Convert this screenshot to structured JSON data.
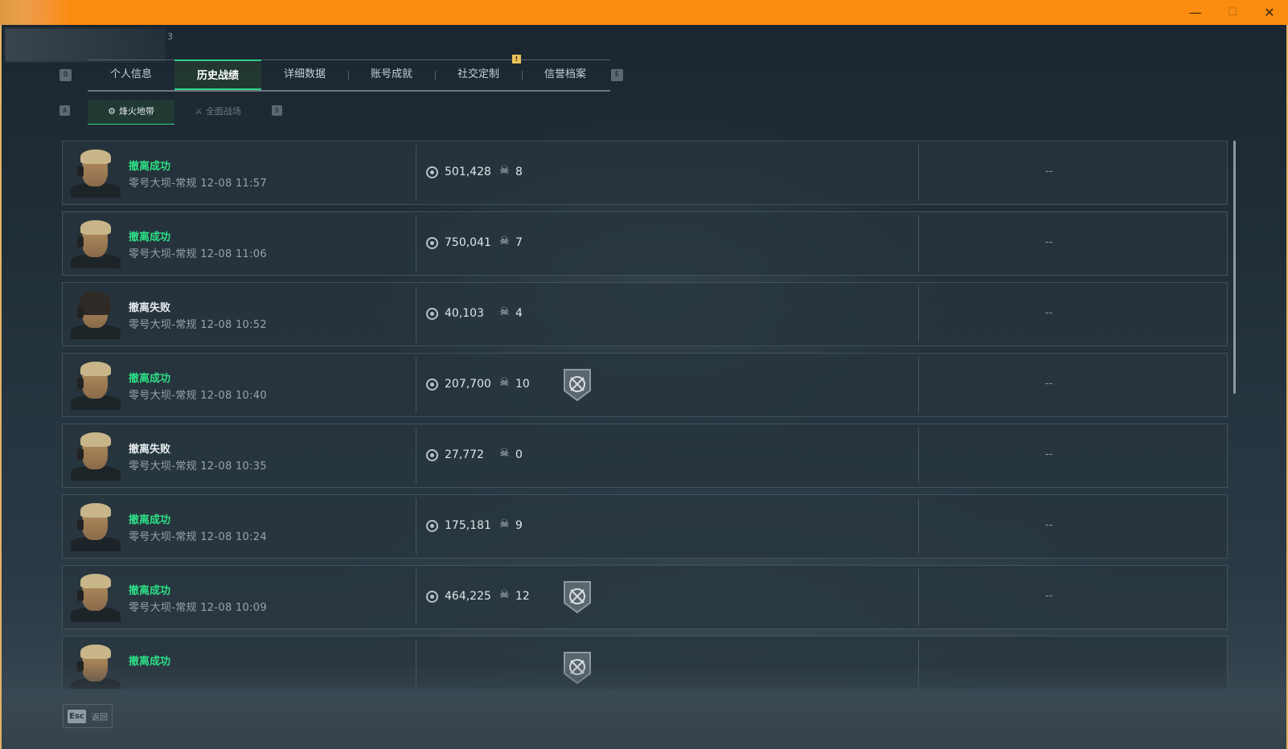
{
  "window": {
    "minimize_glyph": "—",
    "maximize_glyph": "☐",
    "close_glyph": "✕"
  },
  "profile": {
    "number": "3"
  },
  "key_hints": {
    "tabs_left": "Q",
    "tabs_right": "E",
    "sub_left": "A",
    "sub_right": "D"
  },
  "main_tabs": [
    {
      "label": "个人信息",
      "active": false
    },
    {
      "label": "历史战绩",
      "active": true
    },
    {
      "label": "详细数据",
      "active": false
    },
    {
      "label": "账号成就",
      "active": false
    },
    {
      "label": "社交定制",
      "active": false,
      "badge": "!"
    },
    {
      "label": "信誉档案",
      "active": false
    }
  ],
  "sub_tabs": [
    {
      "label": "烽火地带",
      "icon": "mode-icon",
      "active": true
    },
    {
      "label": "全面战场",
      "icon": "battlefield-icon",
      "active": false
    }
  ],
  "matches": [
    {
      "status": "撤离成功",
      "result": "success",
      "map": "零号大坝-常规",
      "time": "12-08 11:57",
      "value": "501,428",
      "kills": "8",
      "medal": false,
      "extra": "--",
      "avatar": "blond"
    },
    {
      "status": "撤离成功",
      "result": "success",
      "map": "零号大坝-常规",
      "time": "12-08 11:06",
      "value": "750,041",
      "kills": "7",
      "medal": false,
      "extra": "--",
      "avatar": "blond"
    },
    {
      "status": "撤离失败",
      "result": "fail",
      "map": "零号大坝-常规",
      "time": "12-08 10:52",
      "value": "40,103",
      "kills": "4",
      "medal": false,
      "extra": "--",
      "avatar": "dark"
    },
    {
      "status": "撤离成功",
      "result": "success",
      "map": "零号大坝-常规",
      "time": "12-08 10:40",
      "value": "207,700",
      "kills": "10",
      "medal": true,
      "extra": "--",
      "avatar": "blond"
    },
    {
      "status": "撤离失败",
      "result": "fail",
      "map": "零号大坝-常规",
      "time": "12-08 10:35",
      "value": "27,772",
      "kills": "0",
      "medal": false,
      "extra": "--",
      "avatar": "blond"
    },
    {
      "status": "撤离成功",
      "result": "success",
      "map": "零号大坝-常规",
      "time": "12-08 10:24",
      "value": "175,181",
      "kills": "9",
      "medal": false,
      "extra": "--",
      "avatar": "blond"
    },
    {
      "status": "撤离成功",
      "result": "success",
      "map": "零号大坝-常规",
      "time": "12-08 10:09",
      "value": "464,225",
      "kills": "12",
      "medal": true,
      "extra": "--",
      "avatar": "blond"
    },
    {
      "status": "撤离成功",
      "result": "success",
      "map": "",
      "time": "",
      "value": "",
      "kills": "",
      "medal": true,
      "extra": "",
      "avatar": "blond"
    }
  ],
  "footer": {
    "esc_key": "Esc",
    "esc_label": "返回"
  },
  "colors": {
    "accent": "#2fd08a",
    "success": "#2ddf86",
    "titlebar": "#fb8c0f"
  }
}
